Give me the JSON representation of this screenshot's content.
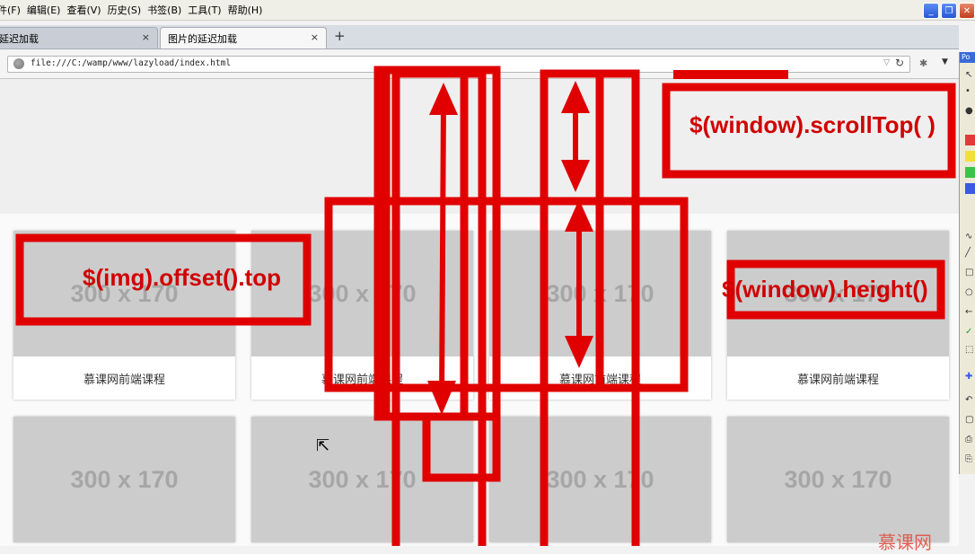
{
  "menubar": {
    "items": [
      "件(F)",
      "编辑(E)",
      "查看(V)",
      "历史(S)",
      "书签(B)",
      "工具(T)",
      "帮助(H)"
    ]
  },
  "tabs": [
    {
      "label": "延迟加载",
      "close": "×"
    },
    {
      "label": "图片的延迟加载",
      "close": "×"
    }
  ],
  "new_tab_label": "+",
  "address_bar": {
    "url": "file:///C:/wamp/www/lazyload/index.html"
  },
  "cards": [
    {
      "image_text": "300 x 170",
      "caption": "慕课网前端课程"
    },
    {
      "image_text": "300 x 170",
      "caption": "慕课网前端课程"
    },
    {
      "image_text": "300 x 170",
      "caption": "慕课网前端课程"
    },
    {
      "image_text": "300 x 170",
      "caption": "慕课网前端课程"
    },
    {
      "image_text": "300 x 170",
      "caption": ""
    },
    {
      "image_text": "300 x 170",
      "caption": ""
    },
    {
      "image_text": "300 x 170",
      "caption": ""
    },
    {
      "image_text": "300 x 170",
      "caption": ""
    }
  ],
  "annotations": {
    "scroll_top": "$(window).scrollTop( )",
    "offset_top": "$(img).offset().top",
    "window_height": "$(window).height()"
  },
  "palette_title": "Po",
  "corner_logo": "慕课网",
  "colors": {
    "annotation_red": "#e00000",
    "placeholder_gray": "#cccccc",
    "placeholder_text": "#a6a6a6"
  }
}
